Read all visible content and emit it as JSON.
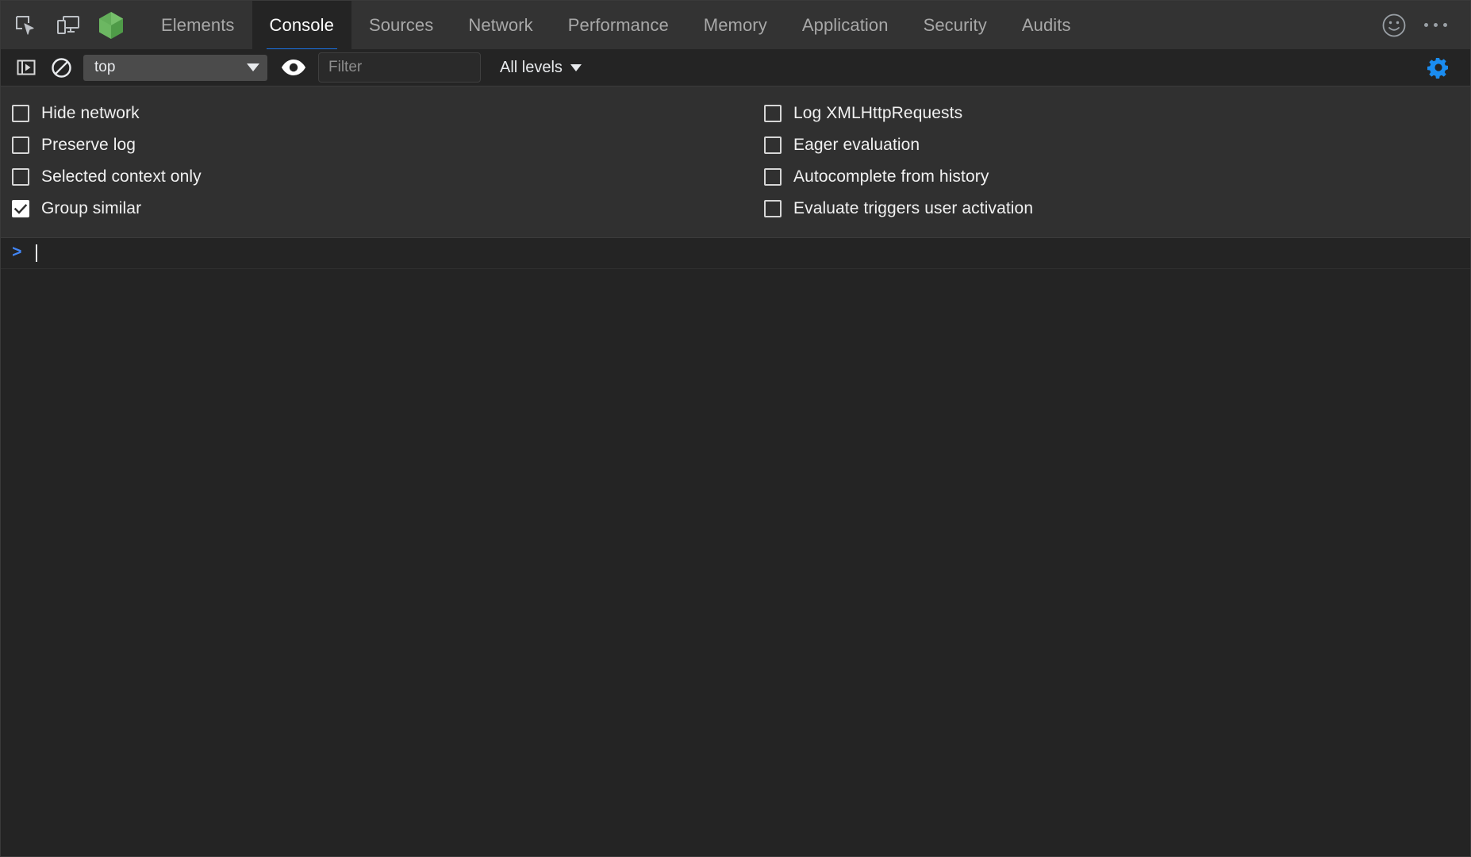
{
  "tabbar": {
    "icons": [
      {
        "name": "inspect-element-icon",
        "title": "Inspect element"
      },
      {
        "name": "device-toolbar-icon",
        "title": "Toggle device toolbar"
      },
      {
        "name": "vue-devtools-cube-icon",
        "title": "Vue"
      }
    ],
    "tabs": [
      {
        "label": "Elements",
        "selected": false
      },
      {
        "label": "Console",
        "selected": true
      },
      {
        "label": "Sources",
        "selected": false
      },
      {
        "label": "Network",
        "selected": false
      },
      {
        "label": "Performance",
        "selected": false
      },
      {
        "label": "Memory",
        "selected": false
      },
      {
        "label": "Application",
        "selected": false
      },
      {
        "label": "Security",
        "selected": false
      },
      {
        "label": "Audits",
        "selected": false
      }
    ],
    "right_icons": [
      {
        "name": "feedback-smiley-icon"
      },
      {
        "name": "more-options-icon"
      }
    ],
    "selected_accent": "#1a73e8"
  },
  "toolbar": {
    "sidebar_toggle": "console-sidebar-toggle-icon",
    "clear_console": "clear-console-icon",
    "context": {
      "value": "top",
      "caret": "chevron-down-icon"
    },
    "live_expression": "eye-icon",
    "filter": {
      "value": "",
      "placeholder": "Filter"
    },
    "levels": {
      "label": "All levels",
      "caret": "chevron-down-icon"
    },
    "settings": {
      "name": "console-settings-gear-icon",
      "active": true,
      "color": "#1a73e8"
    }
  },
  "settings_panel": {
    "left_column": [
      {
        "label": "Hide network",
        "checked": false
      },
      {
        "label": "Preserve log",
        "checked": false
      },
      {
        "label": "Selected context only",
        "checked": false
      },
      {
        "label": "Group similar",
        "checked": true
      }
    ],
    "right_column": [
      {
        "label": "Log XMLHttpRequests",
        "checked": false
      },
      {
        "label": "Eager evaluation",
        "checked": false
      },
      {
        "label": "Autocomplete from history",
        "checked": false
      },
      {
        "label": "Evaluate triggers user activation",
        "checked": false
      }
    ]
  },
  "console": {
    "prompt_symbol": ">",
    "input_value": ""
  }
}
